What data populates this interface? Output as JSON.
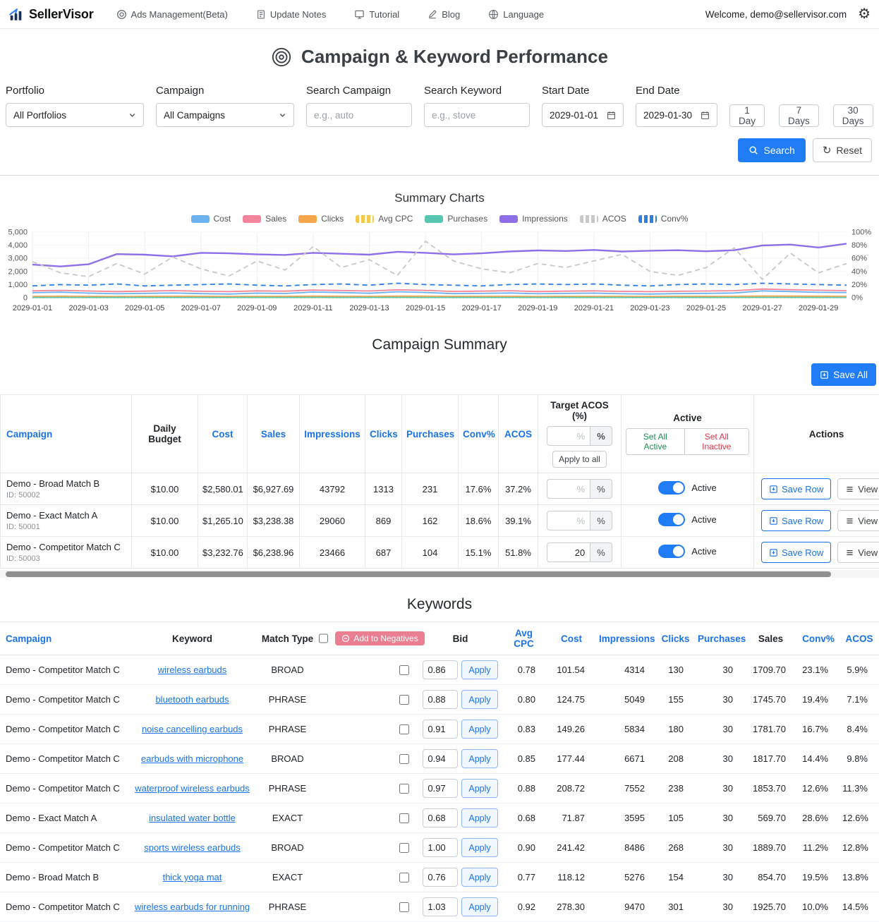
{
  "navbar": {
    "brand": "SellerVisor",
    "items": [
      {
        "label": "Ads Management(Beta)"
      },
      {
        "label": "Update Notes"
      },
      {
        "label": "Tutorial"
      },
      {
        "label": "Blog"
      },
      {
        "label": "Language"
      }
    ],
    "welcome": "Welcome, demo@sellervisor.com"
  },
  "page": {
    "title": "Campaign & Keyword Performance"
  },
  "filters": {
    "portfolio": {
      "label": "Portfolio",
      "value": "All Portfolios"
    },
    "campaign": {
      "label": "Campaign",
      "value": "All Campaigns"
    },
    "search_campaign": {
      "label": "Search Campaign",
      "placeholder": "e.g., auto"
    },
    "search_keyword": {
      "label": "Search Keyword",
      "placeholder": "e.g., stove"
    },
    "start_date": {
      "label": "Start Date",
      "value": "2029-01-01"
    },
    "end_date": {
      "label": "End Date",
      "value": "2029-01-30"
    },
    "quick_ranges": [
      "1 Day",
      "7 Days",
      "30 Days"
    ],
    "search_label": "Search",
    "reset_label": "Reset"
  },
  "summary_charts": {
    "title": "Summary Charts"
  },
  "chart_data": {
    "type": "line",
    "x": [
      "2029-01-01",
      "2029-01-02",
      "2029-01-03",
      "2029-01-04",
      "2029-01-05",
      "2029-01-06",
      "2029-01-07",
      "2029-01-08",
      "2029-01-09",
      "2029-01-10",
      "2029-01-11",
      "2029-01-12",
      "2029-01-13",
      "2029-01-14",
      "2029-01-15",
      "2029-01-16",
      "2029-01-17",
      "2029-01-18",
      "2029-01-19",
      "2029-01-20",
      "2029-01-21",
      "2029-01-22",
      "2029-01-23",
      "2029-01-24",
      "2029-01-25",
      "2029-01-26",
      "2029-01-27",
      "2029-01-28",
      "2029-01-29",
      "2029-01-30"
    ],
    "left_axis": {
      "range": [
        0,
        5000
      ],
      "ticks": [
        "0",
        "1,000",
        "2,000",
        "3,000",
        "4,000",
        "5,000"
      ]
    },
    "right_axis": {
      "range": [
        0,
        100
      ],
      "ticks": [
        "0%",
        "20%",
        "40%",
        "60%",
        "80%",
        "100%"
      ]
    },
    "legend_position": "top",
    "series": [
      {
        "name": "Cost",
        "axis": "left",
        "style": "solid",
        "color": "#6cb2f0",
        "values": [
          380,
          420,
          350,
          300,
          330,
          360,
          310,
          280,
          350,
          320,
          430,
          390,
          340,
          450,
          400,
          310,
          330,
          360,
          300,
          330,
          350,
          300,
          280,
          310,
          330,
          360,
          520,
          470,
          410,
          390
        ]
      },
      {
        "name": "Sales",
        "axis": "left",
        "style": "solid",
        "color": "#f4849b",
        "values": [
          520,
          560,
          510,
          470,
          500,
          540,
          490,
          460,
          520,
          500,
          580,
          550,
          510,
          600,
          560,
          480,
          500,
          530,
          470,
          500,
          520,
          480,
          460,
          490,
          510,
          530,
          660,
          610,
          570,
          540
        ]
      },
      {
        "name": "Clicks",
        "axis": "left",
        "style": "solid",
        "color": "#f5a54a",
        "values": [
          100,
          112,
          104,
          94,
          99,
          107,
          97,
          91,
          104,
          99,
          116,
          110,
          103,
          119,
          111,
          95,
          99,
          106,
          94,
          99,
          103,
          95,
          90,
          95,
          99,
          105,
          131,
          121,
          112,
          107
        ]
      },
      {
        "name": "Avg CPC",
        "axis": "left",
        "style": "dotted",
        "color": "#f2c94c",
        "values": [
          0.78,
          0.8,
          0.79,
          0.81,
          0.8,
          0.82,
          0.79,
          0.78,
          0.8,
          0.81,
          0.83,
          0.8,
          0.79,
          0.82,
          0.8,
          0.78,
          0.8,
          0.81,
          0.79,
          0.8,
          0.82,
          0.8,
          0.78,
          0.79,
          0.8,
          0.81,
          0.85,
          0.83,
          0.8,
          0.79
        ]
      },
      {
        "name": "Purchases",
        "axis": "left",
        "style": "solid",
        "color": "#57c7b2",
        "values": [
          22,
          24,
          23,
          21,
          22,
          24,
          21,
          20,
          23,
          22,
          25,
          24,
          23,
          26,
          24,
          21,
          22,
          23,
          21,
          22,
          23,
          21,
          20,
          21,
          22,
          23,
          28,
          26,
          24,
          23
        ]
      },
      {
        "name": "Impressions",
        "axis": "left",
        "style": "solid",
        "color": "#8f6fe8",
        "values": [
          2520,
          2380,
          2550,
          3320,
          3280,
          3150,
          3420,
          3380,
          3300,
          3260,
          3420,
          3350,
          3280,
          3500,
          3420,
          3300,
          3380,
          3520,
          3600,
          3560,
          3640,
          3520,
          3580,
          3620,
          3540,
          3620,
          3980,
          4050,
          3820,
          4120
        ]
      },
      {
        "name": "ACOS",
        "axis": "right",
        "style": "dashed",
        "color": "#c8c8c8",
        "values": [
          55,
          38,
          32,
          52,
          36,
          62,
          44,
          33,
          56,
          42,
          78,
          46,
          58,
          34,
          86,
          56,
          44,
          38,
          52,
          46,
          56,
          66,
          40,
          34,
          46,
          76,
          28,
          68,
          38,
          52
        ]
      },
      {
        "name": "Conv%",
        "axis": "right",
        "style": "dashed",
        "color": "#2f7fe0",
        "values": [
          18,
          20,
          19,
          21,
          18,
          19,
          20,
          21,
          19,
          18,
          20,
          21,
          19,
          22,
          20,
          19,
          18,
          20,
          21,
          20,
          21,
          19,
          18,
          20,
          21,
          20,
          22,
          21,
          20,
          19
        ]
      }
    ]
  },
  "campaign_summary": {
    "title": "Campaign Summary",
    "save_all_label": "Save All",
    "headers": {
      "campaign": "Campaign",
      "daily_budget": "Daily Budget",
      "cost": "Cost",
      "sales": "Sales",
      "impressions": "Impressions",
      "clicks": "Clicks",
      "purchases": "Purchases",
      "conv": "Conv%",
      "acos": "ACOS",
      "target_acos": "Target ACOS (%)",
      "apply_to_all": "Apply to all",
      "active": "Active",
      "set_all_active": "Set All Active",
      "set_all_inactive": "Set All Inactive",
      "actions": "Actions",
      "percent_suffix": "%"
    },
    "rows": [
      {
        "campaign": "Demo - Broad Match B",
        "campaign_id": "ID: 50002",
        "daily_budget": "$10.00",
        "cost": "$2,580.01",
        "sales": "$6,927.69",
        "impressions": "43792",
        "clicks": "1313",
        "purchases": "231",
        "conv": "17.6%",
        "acos": "37.2%",
        "target_acos": "",
        "active": true,
        "active_label": "Active",
        "save_label": "Save Row",
        "view_label": "View"
      },
      {
        "campaign": "Demo - Exact Match A",
        "campaign_id": "ID: 50001",
        "daily_budget": "$10.00",
        "cost": "$1,265.10",
        "sales": "$3,238.38",
        "impressions": "29060",
        "clicks": "869",
        "purchases": "162",
        "conv": "18.6%",
        "acos": "39.1%",
        "target_acos": "",
        "active": true,
        "active_label": "Active",
        "save_label": "Save Row",
        "view_label": "View"
      },
      {
        "campaign": "Demo - Competitor Match C",
        "campaign_id": "ID: 50003",
        "daily_budget": "$10.00",
        "cost": "$3,232.76",
        "sales": "$6,238.96",
        "impressions": "23466",
        "clicks": "687",
        "purchases": "104",
        "conv": "15.1%",
        "acos": "51.8%",
        "target_acos": "20",
        "active": true,
        "active_label": "Active",
        "save_label": "Save Row",
        "view_label": "View"
      }
    ]
  },
  "keywords": {
    "title": "Keywords",
    "add_to_negatives": "Add to Negatives",
    "apply_label": "Apply",
    "headers": {
      "campaign": "Campaign",
      "keyword": "Keyword",
      "match_type": "Match Type",
      "bid": "Bid",
      "avg_cpc": "Avg CPC",
      "cost": "Cost",
      "impressions": "Impressions",
      "clicks": "Clicks",
      "purchases": "Purchases",
      "sales": "Sales",
      "conv": "Conv%",
      "acos": "ACOS"
    },
    "rows": [
      {
        "campaign": "Demo - Competitor Match C",
        "keyword": "wireless earbuds",
        "match_type": "BROAD",
        "bid": "0.86",
        "avg_cpc": "0.78",
        "cost": "101.54",
        "impressions": "4314",
        "clicks": "130",
        "purchases": "30",
        "sales": "1709.70",
        "conv": "23.1%",
        "acos": "5.9%"
      },
      {
        "campaign": "Demo - Competitor Match C",
        "keyword": "bluetooth earbuds",
        "match_type": "PHRASE",
        "bid": "0.88",
        "avg_cpc": "0.80",
        "cost": "124.75",
        "impressions": "5049",
        "clicks": "155",
        "purchases": "30",
        "sales": "1745.70",
        "conv": "19.4%",
        "acos": "7.1%"
      },
      {
        "campaign": "Demo - Competitor Match C",
        "keyword": "noise cancelling earbuds",
        "match_type": "PHRASE",
        "bid": "0.91",
        "avg_cpc": "0.83",
        "cost": "149.26",
        "impressions": "5834",
        "clicks": "180",
        "purchases": "30",
        "sales": "1781.70",
        "conv": "16.7%",
        "acos": "8.4%"
      },
      {
        "campaign": "Demo - Competitor Match C",
        "keyword": "earbuds with microphone",
        "match_type": "BROAD",
        "bid": "0.94",
        "avg_cpc": "0.85",
        "cost": "177.44",
        "impressions": "6671",
        "clicks": "208",
        "purchases": "30",
        "sales": "1817.70",
        "conv": "14.4%",
        "acos": "9.8%"
      },
      {
        "campaign": "Demo - Competitor Match C",
        "keyword": "waterproof wireless earbuds",
        "match_type": "PHRASE",
        "bid": "0.97",
        "avg_cpc": "0.88",
        "cost": "208.72",
        "impressions": "7552",
        "clicks": "238",
        "purchases": "30",
        "sales": "1853.70",
        "conv": "12.6%",
        "acos": "11.3%"
      },
      {
        "campaign": "Demo - Exact Match A",
        "keyword": "insulated water bottle",
        "match_type": "EXACT",
        "bid": "0.68",
        "avg_cpc": "0.68",
        "cost": "71.87",
        "impressions": "3595",
        "clicks": "105",
        "purchases": "30",
        "sales": "569.70",
        "conv": "28.6%",
        "acos": "12.6%"
      },
      {
        "campaign": "Demo - Competitor Match C",
        "keyword": "sports wireless earbuds",
        "match_type": "BROAD",
        "bid": "1.00",
        "avg_cpc": "0.90",
        "cost": "241.42",
        "impressions": "8486",
        "clicks": "268",
        "purchases": "30",
        "sales": "1889.70",
        "conv": "11.2%",
        "acos": "12.8%"
      },
      {
        "campaign": "Demo - Broad Match B",
        "keyword": "thick yoga mat",
        "match_type": "EXACT",
        "bid": "0.76",
        "avg_cpc": "0.77",
        "cost": "118.12",
        "impressions": "5276",
        "clicks": "154",
        "purchases": "30",
        "sales": "854.70",
        "conv": "19.5%",
        "acos": "13.8%"
      },
      {
        "campaign": "Demo - Competitor Match C",
        "keyword": "wireless earbuds for running",
        "match_type": "PHRASE",
        "bid": "1.03",
        "avg_cpc": "0.92",
        "cost": "278.30",
        "impressions": "9470",
        "clicks": "301",
        "purchases": "30",
        "sales": "1925.70",
        "conv": "10.0%",
        "acos": "14.5%"
      }
    ]
  }
}
